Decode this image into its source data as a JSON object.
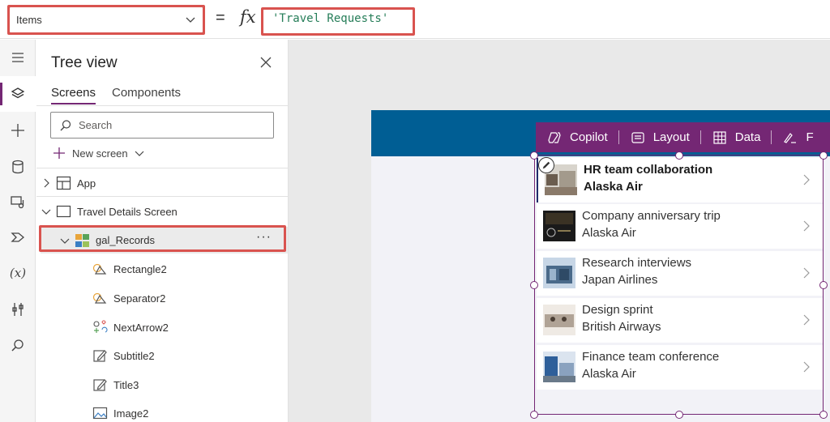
{
  "formula_bar": {
    "property": "Items",
    "equals": "=",
    "fx": "fx",
    "formula": "'Travel Requests'"
  },
  "left_rail": {
    "items": [
      {
        "icon": "hamburger-menu-icon"
      },
      {
        "icon": "layers-icon",
        "active": true
      },
      {
        "icon": "plus-icon"
      },
      {
        "icon": "database-icon"
      },
      {
        "icon": "media-icon"
      },
      {
        "icon": "power-automate-icon"
      },
      {
        "icon": "variables-icon",
        "text": "(x)"
      },
      {
        "icon": "tools-icon"
      },
      {
        "icon": "search-icon"
      }
    ]
  },
  "tree_view": {
    "title": "Tree view",
    "tabs": [
      {
        "label": "Screens",
        "active": true
      },
      {
        "label": "Components",
        "active": false
      }
    ],
    "search_placeholder": "Search",
    "new_screen_label": "New screen",
    "app_label": "App",
    "screen_label": "Travel Details Screen",
    "gallery_label": "gal_Records",
    "more_label": "···",
    "children": [
      {
        "label": "Rectangle2",
        "icon": "rectangle-shape-icon"
      },
      {
        "label": "Separator2",
        "icon": "rectangle-shape-icon"
      },
      {
        "label": "NextArrow2",
        "icon": "icon-control-icon"
      },
      {
        "label": "Subtitle2",
        "icon": "label-edit-icon"
      },
      {
        "label": "Title3",
        "icon": "label-edit-icon"
      },
      {
        "label": "Image2",
        "icon": "image-icon"
      }
    ]
  },
  "command_bar": {
    "items": [
      {
        "label": "Copilot",
        "icon": "copilot-icon"
      },
      {
        "label": "Layout",
        "icon": "layout-icon"
      },
      {
        "label": "Data",
        "icon": "table-icon"
      },
      {
        "label": "F",
        "icon": "pen-icon"
      }
    ]
  },
  "gallery": {
    "rows": [
      {
        "title": "HR team collaboration",
        "subtitle": "Alaska Air"
      },
      {
        "title": "Company anniversary trip",
        "subtitle": "Alaska Air"
      },
      {
        "title": "Research interviews",
        "subtitle": "Japan Airlines"
      },
      {
        "title": "Design sprint",
        "subtitle": "British Airways"
      },
      {
        "title": "Finance team conference",
        "subtitle": "Alaska Air"
      }
    ]
  },
  "colors": {
    "accent": "#742774",
    "header": "#005e94",
    "highlight": "#d9534f",
    "formula_text": "#257d58"
  }
}
